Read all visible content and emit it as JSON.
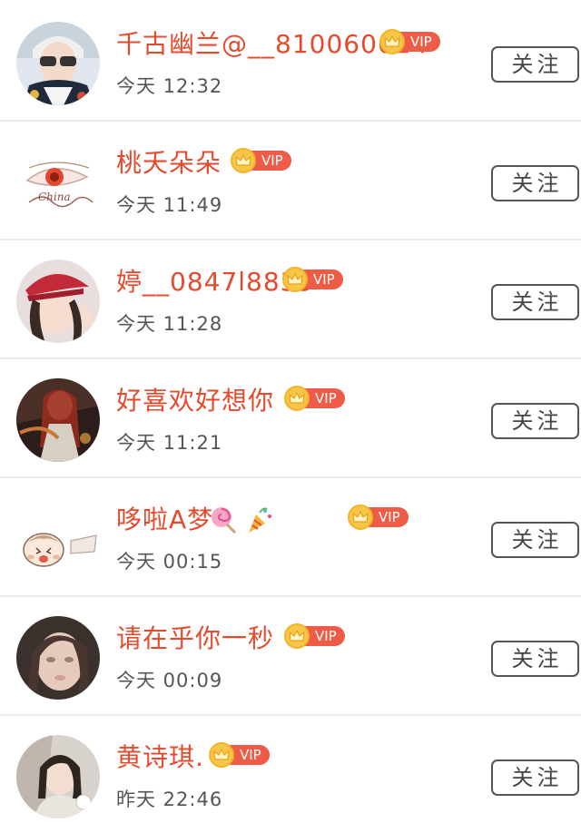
{
  "follow_list": {
    "follow_label": "关注",
    "vip_label": "VIP",
    "items": [
      {
        "name": "千古幽兰@__810060624",
        "time": "今天 12:32"
      },
      {
        "name": "桃夭朵朵",
        "time": "今天 11:49"
      },
      {
        "name": "婷__0847l8839",
        "time": "今天 11:28"
      },
      {
        "name": "好喜欢好想你",
        "time": "今天 11:21"
      },
      {
        "name": "哆啦A梦",
        "time": "今天 00:15"
      },
      {
        "name": "请在乎你一秒",
        "time": "今天 00:09"
      },
      {
        "name": "黄诗琪.",
        "time": "昨天 22:46"
      }
    ]
  },
  "avatars": {
    "item2_watermark": "China"
  },
  "colors": {
    "name": "#e44a2c",
    "vip_badge": "#ee5c47",
    "vip_crown": "#f7c548",
    "divider": "#ebebeb",
    "button_border": "#555555"
  }
}
